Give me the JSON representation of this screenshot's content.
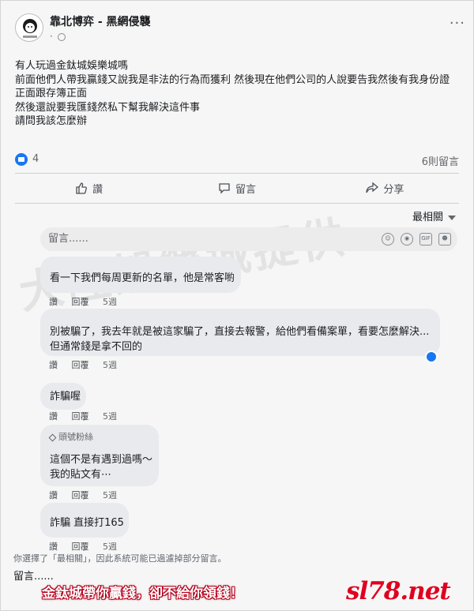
{
  "post": {
    "group_name": "靠北博弈 - 黑網侵襲",
    "meta": "·",
    "more_label": "···",
    "lines": [
      "有人玩過金鈦城娛樂城嗎",
      "前面他們人帶我贏錢又說我是非法的行為而獲利 然後現在他們公司的人說要告我然後有我身份證",
      "正面跟存簿正面",
      "然後還說要我匯錢然私下幫我解決這件事",
      "請問我該怎麼辦"
    ],
    "reaction_count": "4",
    "comment_count": "6則留言"
  },
  "actions": {
    "like": "讚",
    "comment": "留言",
    "share": "分享"
  },
  "sort_label": "最相關",
  "comment_input": {
    "placeholder": "留言......",
    "gif": "GIF"
  },
  "comments": [
    {
      "lines": [
        "看一下我們每周更新的名單，他是常客喲"
      ],
      "like": "讚",
      "reply": "回覆",
      "time": "5週"
    },
    {
      "lines": [
        "別被騙了，我去年就是被這家騙了，直接去報警，給他們看備案單，看要怎麼解決...",
        "但通常錢是拿不回的"
      ],
      "like": "讚",
      "reply": "回覆",
      "time": "5週"
    },
    {
      "lines": [
        "詐騙喔"
      ],
      "like": "讚",
      "reply": "回覆",
      "time": "5週"
    },
    {
      "badge": "頭號粉絲",
      "lines": [
        "這個不是有遇到過嗎～",
        "我的貼文有⋯"
      ],
      "like": "讚",
      "reply": "回覆",
      "time": "5週"
    },
    {
      "lines": [
        "詐騙 直接打165"
      ],
      "like": "讚",
      "reply": "回覆",
      "time": "5週"
    }
  ],
  "filter_note": "你選擇了「最相關」，因此系統可能已過濾掉部分留言。",
  "reply_placeholder": "留言......",
  "promo": {
    "text": "金鈦城帶你贏錢，卻不給你領錢！",
    "url": "sl78.net"
  },
  "watermark": "大陸娛樂城提供"
}
